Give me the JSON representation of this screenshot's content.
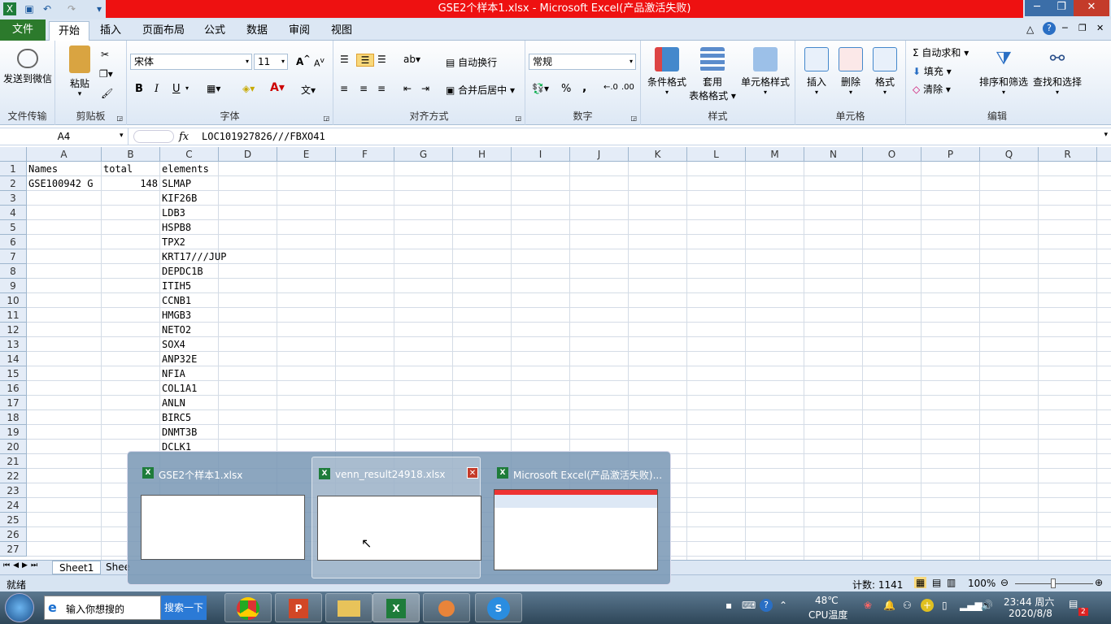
{
  "window": {
    "title": "GSE2个样本1.xlsx -  Microsoft Excel(产品激活失败)"
  },
  "ribbon_tabs": [
    "文件",
    "开始",
    "插入",
    "页面布局",
    "公式",
    "数据",
    "审阅",
    "视图"
  ],
  "ribbon": {
    "send_wechat": "发送到微信",
    "file_transfer": "文件传输",
    "paste": "粘贴",
    "clipboard": "剪贴板",
    "font_name": "宋体",
    "font_size": "11",
    "font_group": "字体",
    "wrap_text": "自动换行",
    "merge_center": "合并后居中",
    "align_group": "对齐方式",
    "number_format": "常规",
    "number_group": "数字",
    "cond_format": "条件格式",
    "table_format_1": "套用",
    "table_format_2": "表格格式",
    "cell_style": "单元格样式",
    "style_group": "样式",
    "insert": "插入",
    "delete": "删除",
    "format": "格式",
    "cells_group": "单元格",
    "autosum": "自动求和",
    "fill": "填充",
    "clear": "清除",
    "sort_filter": "排序和筛选",
    "find_select": "查找和选择",
    "edit_group": "编辑",
    "bold": "B",
    "italic": "I",
    "underline": "U",
    "percent": "%",
    "comma": ","
  },
  "formula_bar": {
    "name_box": "A4",
    "fx": "fx",
    "formula": "LOC101927826///FBXO41"
  },
  "columns": [
    "A",
    "B",
    "C",
    "D",
    "E",
    "F",
    "G",
    "H",
    "I",
    "J",
    "K",
    "L",
    "M",
    "N",
    "O",
    "P",
    "Q",
    "R"
  ],
  "rows": [
    "1",
    "2",
    "3",
    "4",
    "5",
    "6",
    "7",
    "8",
    "9",
    "10",
    "11",
    "12",
    "13",
    "14",
    "15",
    "16",
    "17",
    "18",
    "19",
    "20",
    "21",
    "22",
    "23",
    "24",
    "25",
    "26",
    "27"
  ],
  "cells": {
    "a1": "Names",
    "b1": "total",
    "c1": "elements",
    "a2": "GSE100942 G",
    "b2": "148",
    "c_values": [
      "SLMAP",
      "KIF26B",
      "LDB3",
      "HSPB8",
      "TPX2",
      "KRT17///JUP",
      "DEPDC1B",
      "ITIH5",
      "CCNB1",
      "HMGB3",
      "NETO2",
      "SOX4",
      "ANP32E",
      "NFIA",
      "COL1A1",
      "ANLN",
      "BIRC5",
      "DNMT3B",
      "DCLK1"
    ]
  },
  "sheet_tabs": [
    "Sheet1",
    "Shee"
  ],
  "status": {
    "ready": "就绪",
    "count": "计数: 1141",
    "zoom": "100%"
  },
  "popup": {
    "items": [
      {
        "title": "GSE2个样本1.xlsx"
      },
      {
        "title": "venn_result24918.xlsx"
      },
      {
        "title": "Microsoft Excel(产品激活失败)..."
      }
    ]
  },
  "taskbar": {
    "search_placeholder": "输入你想搜的",
    "search_button": "搜索一下",
    "temp": "48℃",
    "temp_label": "CPU温度",
    "time": "23:44 周六",
    "date": "2020/8/8",
    "badge": "2"
  },
  "colors": {
    "title_red": "#ee1111",
    "file_tab": "#2c7a2c",
    "excel_green": "#1e7c3a"
  }
}
